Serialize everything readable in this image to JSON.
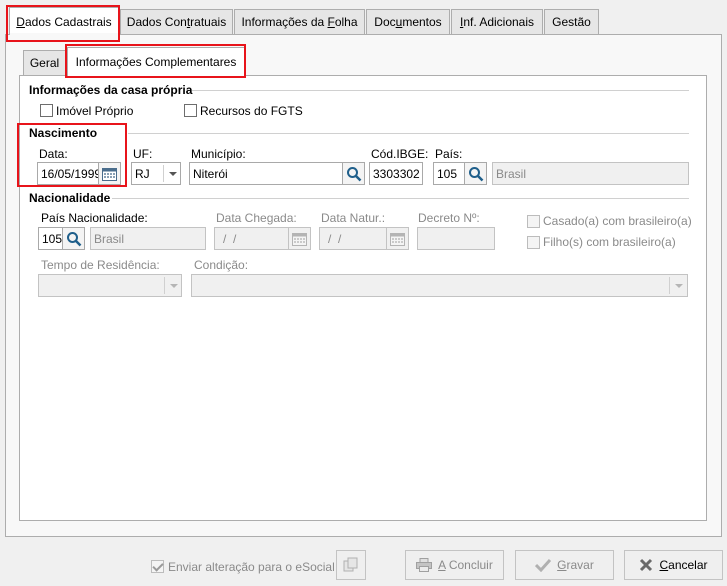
{
  "tabs": [
    {
      "pre": "",
      "acc": "D",
      "post": "ados Cadastrais"
    },
    {
      "pre": "Dados Con",
      "acc": "t",
      "post": "ratuais"
    },
    {
      "pre": "Informações da ",
      "acc": "F",
      "post": "olha"
    },
    {
      "pre": "Doc",
      "acc": "u",
      "post": "mentos"
    },
    {
      "pre": "",
      "acc": "I",
      "post": "nf. Adicionais"
    },
    {
      "pre": "Gestão",
      "acc": "",
      "post": ""
    }
  ],
  "subtabs": [
    "Geral",
    "Informações Complementares"
  ],
  "casa_propria": {
    "title": "Informações da casa própria",
    "imovel_label": "Imóvel Próprio",
    "fgts_label": "Recursos do FGTS"
  },
  "nascimento": {
    "title": "Nascimento",
    "data_label": "Data:",
    "data_value": "16/05/1999",
    "uf_label": "UF:",
    "uf_value": "RJ",
    "municipio_label": "Município:",
    "municipio_value": "Niterói",
    "ibge_label": "Cód.IBGE:",
    "ibge_value": "3303302",
    "pais_label": "País:",
    "pais_code": "105",
    "pais_name": "Brasil"
  },
  "nacionalidade": {
    "title": "Nacionalidade",
    "pais_nac_label": "País Nacionalidade:",
    "pais_nac_code": "105",
    "pais_nac_name": "Brasil",
    "data_chegada_label": "Data Chegada:",
    "data_chegada_value": "/  /",
    "data_natur_label": "Data Natur.:",
    "data_natur_value": "/  /",
    "decreto_label": "Decreto Nº:",
    "decreto_value": "",
    "casado_label": "Casado(a) com brasileiro(a)",
    "filho_label": "Filho(s) com brasileiro(a)",
    "tempo_label": "Tempo de Residência:",
    "tempo_value": "",
    "condicao_label": "Condição:",
    "condicao_value": ""
  },
  "footer": {
    "esocial_label": "Enviar alteração para o eSocial",
    "concluir": {
      "acc": "A",
      "post": " Concluir"
    },
    "gravar": {
      "acc": "G",
      "post": "ravar"
    },
    "cancelar": {
      "acc": "C",
      "post": "ancelar"
    }
  },
  "colors": {
    "highlight": "#e8141b",
    "search_icon": "#1f5f8b",
    "disabled_text": "#8a8a8a"
  }
}
